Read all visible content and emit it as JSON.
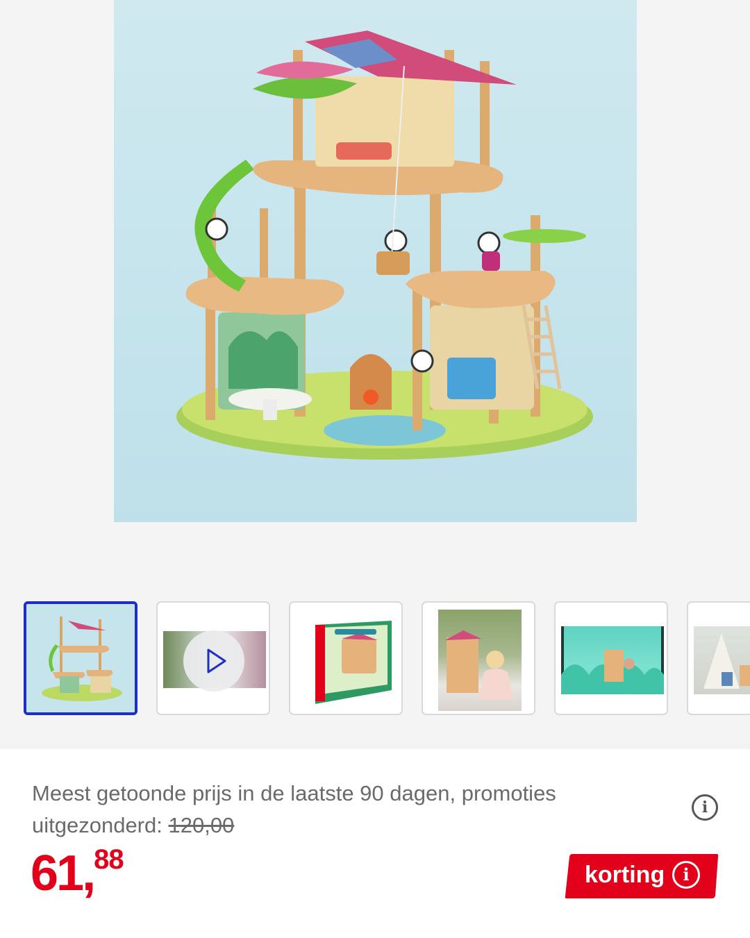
{
  "product": {
    "main_image_alt": "Hape bamboo panda treehouse",
    "lowest_price_text": "Meest getoonde prijs in de laatste 90 dagen, promoties uitgezonderd: ",
    "lowest_price_value": "120,00",
    "price_int": "61,",
    "price_dec": "88",
    "discount_label": "korting",
    "info_glyph": "i"
  },
  "gallery": {
    "selected_index": 0,
    "thumbnails": [
      {
        "kind": "image",
        "icon": "treehouse-photo"
      },
      {
        "kind": "video",
        "icon": "play-icon"
      },
      {
        "kind": "image",
        "icon": "box-packaging-photo"
      },
      {
        "kind": "image",
        "icon": "child-playing-photo"
      },
      {
        "kind": "image",
        "icon": "lifestyle-photo"
      },
      {
        "kind": "image",
        "icon": "tipi-photo"
      }
    ]
  },
  "colors": {
    "brand_red": "#e2001a",
    "selected_border": "#1d2fc7",
    "hero_background": "#c7e5ed"
  }
}
